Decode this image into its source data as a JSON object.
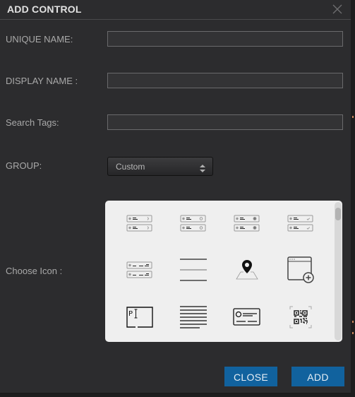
{
  "dialog": {
    "title": "ADD CONTROL",
    "close_icon": "close-x-icon"
  },
  "form": {
    "unique_name": {
      "label": "UNIQUE NAME:",
      "value": "",
      "placeholder": ""
    },
    "display_name": {
      "label": "DISPLAY NAME :",
      "value": "",
      "placeholder": ""
    },
    "search_tags": {
      "label": "Search Tags:",
      "value": "",
      "placeholder": ""
    },
    "group": {
      "label": "GROUP:",
      "selected": "Custom",
      "icon": "sort-arrows-icon"
    },
    "choose_icon": {
      "label": "Choose Icon :"
    }
  },
  "icons": [
    {
      "name": "list-rows-chevron-icon"
    },
    {
      "name": "list-rows-radio-icon"
    },
    {
      "name": "list-rows-radio-filled-icon"
    },
    {
      "name": "list-rows-check-icon"
    },
    {
      "name": "list-rows-columns-icon"
    },
    {
      "name": "horizontal-lines-icon"
    },
    {
      "name": "map-pin-icon"
    },
    {
      "name": "window-add-icon"
    },
    {
      "name": "text-input-cursor-icon"
    },
    {
      "name": "paragraph-lines-icon"
    },
    {
      "name": "id-card-icon"
    },
    {
      "name": "qr-code-scan-icon"
    }
  ],
  "buttons": {
    "close": "CLOSE",
    "add": "ADD"
  },
  "colors": {
    "background": "#2c2c2e",
    "button": "#11629e",
    "panel": "#efefef"
  }
}
